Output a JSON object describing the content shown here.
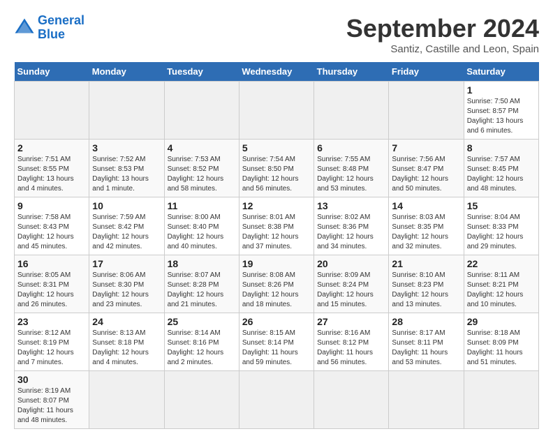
{
  "header": {
    "logo_line1": "General",
    "logo_line2": "Blue",
    "month_title": "September 2024",
    "subtitle": "Santiz, Castille and Leon, Spain"
  },
  "weekdays": [
    "Sunday",
    "Monday",
    "Tuesday",
    "Wednesday",
    "Thursday",
    "Friday",
    "Saturday"
  ],
  "days": [
    {
      "num": "",
      "sunrise": "",
      "sunset": "",
      "daylight": "",
      "empty": true
    },
    {
      "num": "",
      "sunrise": "",
      "sunset": "",
      "daylight": "",
      "empty": true
    },
    {
      "num": "",
      "sunrise": "",
      "sunset": "",
      "daylight": "",
      "empty": true
    },
    {
      "num": "",
      "sunrise": "",
      "sunset": "",
      "daylight": "",
      "empty": true
    },
    {
      "num": "",
      "sunrise": "",
      "sunset": "",
      "daylight": "",
      "empty": true
    },
    {
      "num": "",
      "sunrise": "",
      "sunset": "",
      "daylight": "",
      "empty": true
    },
    {
      "num": "1",
      "sunrise": "Sunrise: 7:50 AM",
      "sunset": "Sunset: 8:57 PM",
      "daylight": "Daylight: 13 hours and 6 minutes."
    },
    {
      "num": "2",
      "sunrise": "Sunrise: 7:51 AM",
      "sunset": "Sunset: 8:55 PM",
      "daylight": "Daylight: 13 hours and 4 minutes."
    },
    {
      "num": "3",
      "sunrise": "Sunrise: 7:52 AM",
      "sunset": "Sunset: 8:53 PM",
      "daylight": "Daylight: 13 hours and 1 minute."
    },
    {
      "num": "4",
      "sunrise": "Sunrise: 7:53 AM",
      "sunset": "Sunset: 8:52 PM",
      "daylight": "Daylight: 12 hours and 58 minutes."
    },
    {
      "num": "5",
      "sunrise": "Sunrise: 7:54 AM",
      "sunset": "Sunset: 8:50 PM",
      "daylight": "Daylight: 12 hours and 56 minutes."
    },
    {
      "num": "6",
      "sunrise": "Sunrise: 7:55 AM",
      "sunset": "Sunset: 8:48 PM",
      "daylight": "Daylight: 12 hours and 53 minutes."
    },
    {
      "num": "7",
      "sunrise": "Sunrise: 7:56 AM",
      "sunset": "Sunset: 8:47 PM",
      "daylight": "Daylight: 12 hours and 50 minutes."
    },
    {
      "num": "8",
      "sunrise": "Sunrise: 7:57 AM",
      "sunset": "Sunset: 8:45 PM",
      "daylight": "Daylight: 12 hours and 48 minutes."
    },
    {
      "num": "9",
      "sunrise": "Sunrise: 7:58 AM",
      "sunset": "Sunset: 8:43 PM",
      "daylight": "Daylight: 12 hours and 45 minutes."
    },
    {
      "num": "10",
      "sunrise": "Sunrise: 7:59 AM",
      "sunset": "Sunset: 8:42 PM",
      "daylight": "Daylight: 12 hours and 42 minutes."
    },
    {
      "num": "11",
      "sunrise": "Sunrise: 8:00 AM",
      "sunset": "Sunset: 8:40 PM",
      "daylight": "Daylight: 12 hours and 40 minutes."
    },
    {
      "num": "12",
      "sunrise": "Sunrise: 8:01 AM",
      "sunset": "Sunset: 8:38 PM",
      "daylight": "Daylight: 12 hours and 37 minutes."
    },
    {
      "num": "13",
      "sunrise": "Sunrise: 8:02 AM",
      "sunset": "Sunset: 8:36 PM",
      "daylight": "Daylight: 12 hours and 34 minutes."
    },
    {
      "num": "14",
      "sunrise": "Sunrise: 8:03 AM",
      "sunset": "Sunset: 8:35 PM",
      "daylight": "Daylight: 12 hours and 32 minutes."
    },
    {
      "num": "15",
      "sunrise": "Sunrise: 8:04 AM",
      "sunset": "Sunset: 8:33 PM",
      "daylight": "Daylight: 12 hours and 29 minutes."
    },
    {
      "num": "16",
      "sunrise": "Sunrise: 8:05 AM",
      "sunset": "Sunset: 8:31 PM",
      "daylight": "Daylight: 12 hours and 26 minutes."
    },
    {
      "num": "17",
      "sunrise": "Sunrise: 8:06 AM",
      "sunset": "Sunset: 8:30 PM",
      "daylight": "Daylight: 12 hours and 23 minutes."
    },
    {
      "num": "18",
      "sunrise": "Sunrise: 8:07 AM",
      "sunset": "Sunset: 8:28 PM",
      "daylight": "Daylight: 12 hours and 21 minutes."
    },
    {
      "num": "19",
      "sunrise": "Sunrise: 8:08 AM",
      "sunset": "Sunset: 8:26 PM",
      "daylight": "Daylight: 12 hours and 18 minutes."
    },
    {
      "num": "20",
      "sunrise": "Sunrise: 8:09 AM",
      "sunset": "Sunset: 8:24 PM",
      "daylight": "Daylight: 12 hours and 15 minutes."
    },
    {
      "num": "21",
      "sunrise": "Sunrise: 8:10 AM",
      "sunset": "Sunset: 8:23 PM",
      "daylight": "Daylight: 12 hours and 13 minutes."
    },
    {
      "num": "22",
      "sunrise": "Sunrise: 8:11 AM",
      "sunset": "Sunset: 8:21 PM",
      "daylight": "Daylight: 12 hours and 10 minutes."
    },
    {
      "num": "23",
      "sunrise": "Sunrise: 8:12 AM",
      "sunset": "Sunset: 8:19 PM",
      "daylight": "Daylight: 12 hours and 7 minutes."
    },
    {
      "num": "24",
      "sunrise": "Sunrise: 8:13 AM",
      "sunset": "Sunset: 8:18 PM",
      "daylight": "Daylight: 12 hours and 4 minutes."
    },
    {
      "num": "25",
      "sunrise": "Sunrise: 8:14 AM",
      "sunset": "Sunset: 8:16 PM",
      "daylight": "Daylight: 12 hours and 2 minutes."
    },
    {
      "num": "26",
      "sunrise": "Sunrise: 8:15 AM",
      "sunset": "Sunset: 8:14 PM",
      "daylight": "Daylight: 11 hours and 59 minutes."
    },
    {
      "num": "27",
      "sunrise": "Sunrise: 8:16 AM",
      "sunset": "Sunset: 8:12 PM",
      "daylight": "Daylight: 11 hours and 56 minutes."
    },
    {
      "num": "28",
      "sunrise": "Sunrise: 8:17 AM",
      "sunset": "Sunset: 8:11 PM",
      "daylight": "Daylight: 11 hours and 53 minutes."
    },
    {
      "num": "29",
      "sunrise": "Sunrise: 8:18 AM",
      "sunset": "Sunset: 8:09 PM",
      "daylight": "Daylight: 11 hours and 51 minutes."
    },
    {
      "num": "30",
      "sunrise": "Sunrise: 8:19 AM",
      "sunset": "Sunset: 8:07 PM",
      "daylight": "Daylight: 11 hours and 48 minutes."
    },
    {
      "num": "",
      "sunrise": "",
      "sunset": "",
      "daylight": "",
      "empty": true
    },
    {
      "num": "",
      "sunrise": "",
      "sunset": "",
      "daylight": "",
      "empty": true
    },
    {
      "num": "",
      "sunrise": "",
      "sunset": "",
      "daylight": "",
      "empty": true
    },
    {
      "num": "",
      "sunrise": "",
      "sunset": "",
      "daylight": "",
      "empty": true
    },
    {
      "num": "",
      "sunrise": "",
      "sunset": "",
      "daylight": "",
      "empty": true
    }
  ]
}
